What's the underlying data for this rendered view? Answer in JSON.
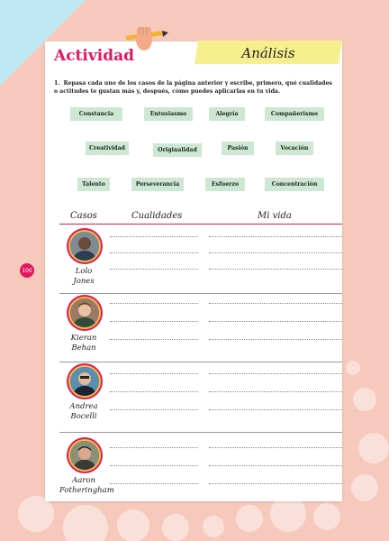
{
  "header": {
    "title": "Actividad",
    "tab": "Análisis"
  },
  "instruction": {
    "number": "1.",
    "text": "Repasa cada uno de los casos de la página anterior y escribe, primero, qué cualidades o actitudes te gustan más y, después, cómo puedes aplicarlas en tu vida."
  },
  "qualities": [
    "Constancia",
    "Entusiasmo",
    "Alegría",
    "Compañerismo",
    "Creatividad",
    "Originalidad",
    "Pasión",
    "Vocación",
    "Talento",
    "Perseverancia",
    "Esfuerzo",
    "Concentración"
  ],
  "table": {
    "headers": [
      "Casos",
      "Cualidades",
      "Mi vida"
    ],
    "cases": [
      {
        "line1": "Lolo",
        "line2": "Jones"
      },
      {
        "line1": "Kieran",
        "line2": "Behan"
      },
      {
        "line1": "Andrea",
        "line2": "Bocelli"
      },
      {
        "line1": "Aaron",
        "line2": "Fotheringham"
      }
    ]
  },
  "page_number": "100",
  "colors": {
    "accent": "#e0185f",
    "chip": "#cde8d2",
    "tab": "#f7ef8e",
    "background": "#f7c9bc"
  }
}
